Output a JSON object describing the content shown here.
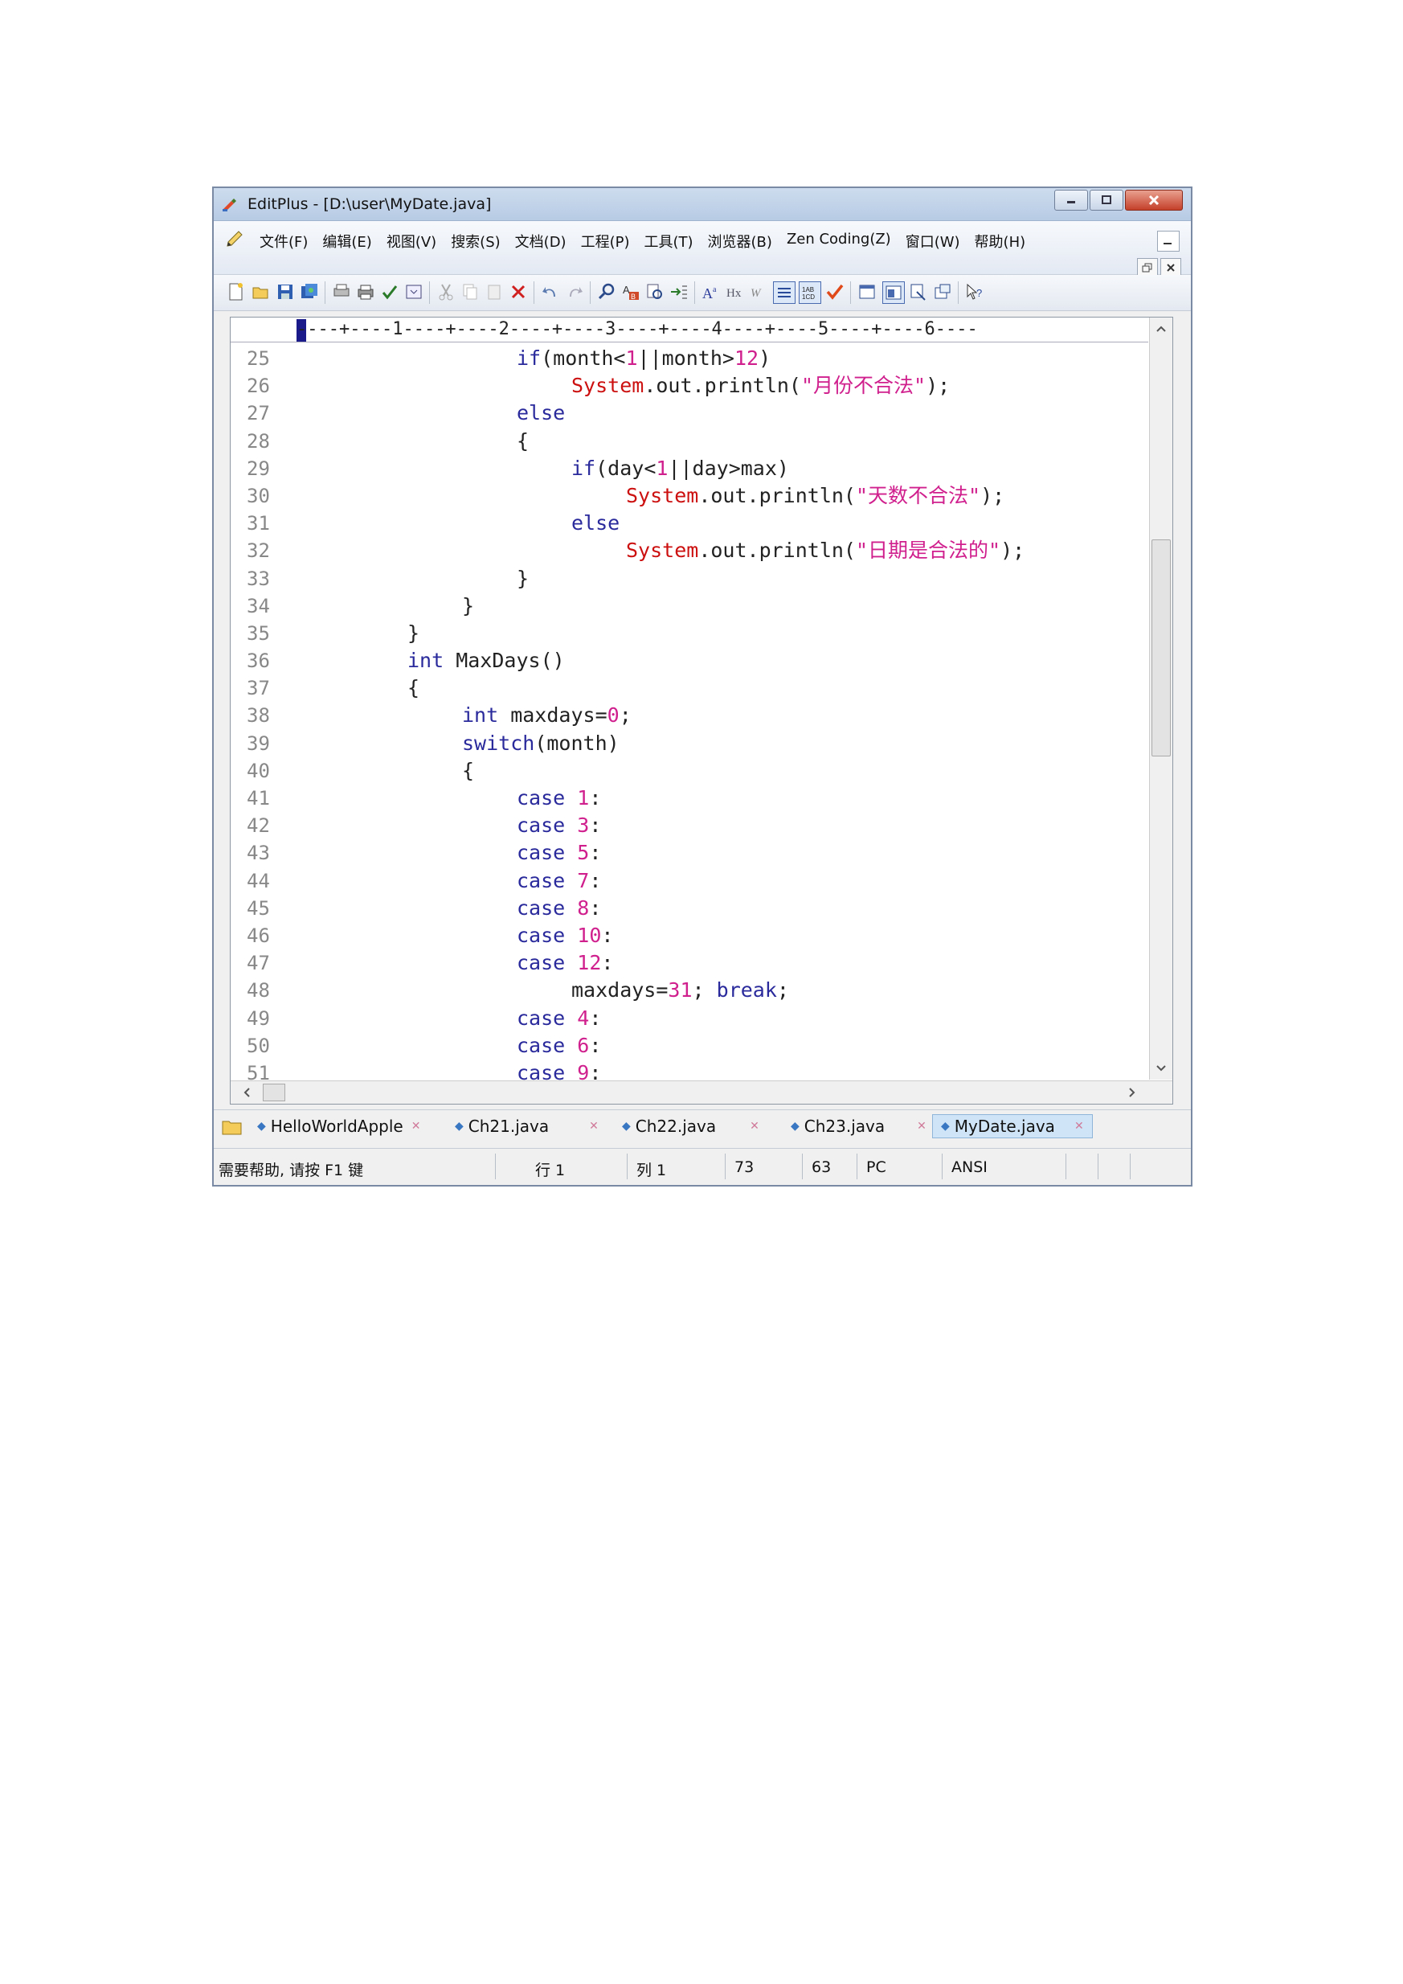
{
  "window": {
    "title": "EditPlus - [D:\\user\\MyDate.java]"
  },
  "menu": {
    "items": [
      "文件(F)",
      "编辑(E)",
      "视图(V)",
      "搜索(S)",
      "文档(D)",
      "工程(P)",
      "工具(T)",
      "浏览器(B)",
      "Zen Coding(Z)",
      "窗口(W)",
      "帮助(H)"
    ]
  },
  "ruler": {
    "text": "----+----1----+----2----+----3----+----4----+----5----+----6----"
  },
  "code": {
    "lines": [
      {
        "n": "25",
        "indent": 4,
        "parts": [
          {
            "t": "if",
            "c": "kw"
          },
          {
            "t": "(month<"
          },
          {
            "t": "1",
            "c": "num"
          },
          {
            "t": "||month>"
          },
          {
            "t": "12",
            "c": "num"
          },
          {
            "t": ")"
          }
        ]
      },
      {
        "n": "26",
        "indent": 5,
        "parts": [
          {
            "t": "System",
            "c": "cls"
          },
          {
            "t": ".out.println("
          },
          {
            "t": "\"月份不合法\"",
            "c": "str"
          },
          {
            "t": ");"
          }
        ]
      },
      {
        "n": "27",
        "indent": 4,
        "parts": [
          {
            "t": "else",
            "c": "kw"
          }
        ]
      },
      {
        "n": "28",
        "indent": 4,
        "parts": [
          {
            "t": "{"
          }
        ]
      },
      {
        "n": "29",
        "indent": 5,
        "parts": [
          {
            "t": "if",
            "c": "kw"
          },
          {
            "t": "(day<"
          },
          {
            "t": "1",
            "c": "num"
          },
          {
            "t": "||day>max)"
          }
        ]
      },
      {
        "n": "30",
        "indent": 6,
        "parts": [
          {
            "t": "System",
            "c": "cls"
          },
          {
            "t": ".out.println("
          },
          {
            "t": "\"天数不合法\"",
            "c": "str"
          },
          {
            "t": ");"
          }
        ]
      },
      {
        "n": "31",
        "indent": 5,
        "parts": [
          {
            "t": "else",
            "c": "kw"
          }
        ]
      },
      {
        "n": "32",
        "indent": 6,
        "parts": [
          {
            "t": "System",
            "c": "cls"
          },
          {
            "t": ".out.println("
          },
          {
            "t": "\"日期是合法的\"",
            "c": "str"
          },
          {
            "t": ");"
          }
        ]
      },
      {
        "n": "33",
        "indent": 4,
        "parts": [
          {
            "t": "}"
          }
        ]
      },
      {
        "n": "34",
        "indent": 3,
        "parts": [
          {
            "t": "}"
          }
        ]
      },
      {
        "n": "35",
        "indent": 2,
        "parts": [
          {
            "t": "}"
          }
        ]
      },
      {
        "n": "36",
        "indent": 2,
        "parts": [
          {
            "t": "int",
            "c": "kw"
          },
          {
            "t": " MaxDays()"
          }
        ]
      },
      {
        "n": "37",
        "indent": 2,
        "parts": [
          {
            "t": "{"
          }
        ]
      },
      {
        "n": "38",
        "indent": 3,
        "parts": [
          {
            "t": "int",
            "c": "kw"
          },
          {
            "t": " maxdays="
          },
          {
            "t": "0",
            "c": "num"
          },
          {
            "t": ";"
          }
        ]
      },
      {
        "n": "39",
        "indent": 3,
        "parts": [
          {
            "t": "switch",
            "c": "kw"
          },
          {
            "t": "(month)"
          }
        ]
      },
      {
        "n": "40",
        "indent": 3,
        "parts": [
          {
            "t": "{"
          }
        ]
      },
      {
        "n": "41",
        "indent": 4,
        "parts": [
          {
            "t": "case",
            "c": "kw"
          },
          {
            "t": " "
          },
          {
            "t": "1",
            "c": "num"
          },
          {
            "t": ":"
          }
        ]
      },
      {
        "n": "42",
        "indent": 4,
        "parts": [
          {
            "t": "case",
            "c": "kw"
          },
          {
            "t": " "
          },
          {
            "t": "3",
            "c": "num"
          },
          {
            "t": ":"
          }
        ]
      },
      {
        "n": "43",
        "indent": 4,
        "parts": [
          {
            "t": "case",
            "c": "kw"
          },
          {
            "t": " "
          },
          {
            "t": "5",
            "c": "num"
          },
          {
            "t": ":"
          }
        ]
      },
      {
        "n": "44",
        "indent": 4,
        "parts": [
          {
            "t": "case",
            "c": "kw"
          },
          {
            "t": " "
          },
          {
            "t": "7",
            "c": "num"
          },
          {
            "t": ":"
          }
        ]
      },
      {
        "n": "45",
        "indent": 4,
        "parts": [
          {
            "t": "case",
            "c": "kw"
          },
          {
            "t": " "
          },
          {
            "t": "8",
            "c": "num"
          },
          {
            "t": ":"
          }
        ]
      },
      {
        "n": "46",
        "indent": 4,
        "parts": [
          {
            "t": "case",
            "c": "kw"
          },
          {
            "t": " "
          },
          {
            "t": "10",
            "c": "num"
          },
          {
            "t": ":"
          }
        ]
      },
      {
        "n": "47",
        "indent": 4,
        "parts": [
          {
            "t": "case",
            "c": "kw"
          },
          {
            "t": " "
          },
          {
            "t": "12",
            "c": "num"
          },
          {
            "t": ":"
          }
        ]
      },
      {
        "n": "48",
        "indent": 5,
        "parts": [
          {
            "t": "maxdays="
          },
          {
            "t": "31",
            "c": "num"
          },
          {
            "t": "; "
          },
          {
            "t": "break",
            "c": "kw"
          },
          {
            "t": ";"
          }
        ]
      },
      {
        "n": "49",
        "indent": 4,
        "parts": [
          {
            "t": "case",
            "c": "kw"
          },
          {
            "t": " "
          },
          {
            "t": "4",
            "c": "num"
          },
          {
            "t": ":"
          }
        ]
      },
      {
        "n": "50",
        "indent": 4,
        "parts": [
          {
            "t": "case",
            "c": "kw"
          },
          {
            "t": " "
          },
          {
            "t": "6",
            "c": "num"
          },
          {
            "t": ":"
          }
        ]
      },
      {
        "n": "51",
        "indent": 4,
        "parts": [
          {
            "t": "case",
            "c": "kw"
          },
          {
            "t": " "
          },
          {
            "t": "9",
            "c": "num"
          },
          {
            "t": ":"
          }
        ]
      }
    ]
  },
  "tabs": [
    {
      "label": "HelloWorldApple",
      "active": false
    },
    {
      "label": "Ch21.java",
      "active": false
    },
    {
      "label": "Ch22.java",
      "active": false
    },
    {
      "label": "Ch23.java",
      "active": false
    },
    {
      "label": "MyDate.java",
      "active": true
    }
  ],
  "status": {
    "help": "需要帮助, 请按 F1 键",
    "row": "行 1",
    "col": "列 1",
    "v1": "73",
    "v2": "63",
    "mode": "PC",
    "encoding": "ANSI"
  },
  "colors": {
    "keyword": "#2a2a9c",
    "number": "#d0208e",
    "string": "#d0208e",
    "class": "#cc1010",
    "line_number": "#888888"
  }
}
